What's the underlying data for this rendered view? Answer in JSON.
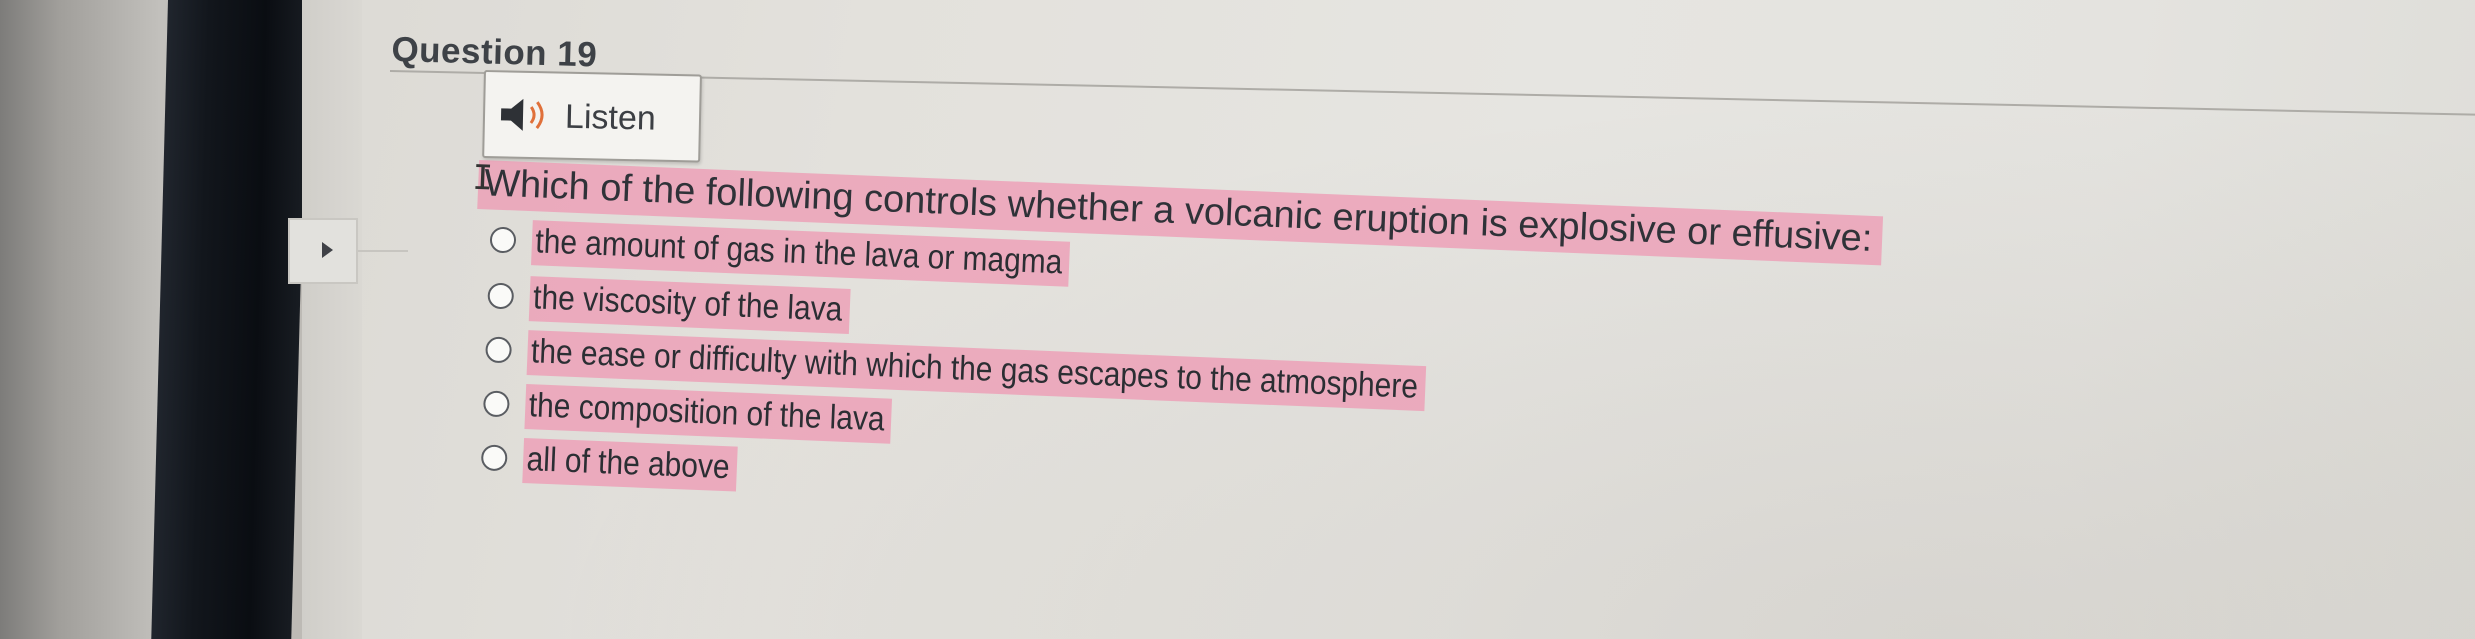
{
  "question": {
    "title": "Question 19",
    "listen_label": "Listen",
    "prompt": "Which of the following controls whether a volcanic eruption is explosive or effusive:",
    "options": [
      {
        "label": "the amount of gas in the lava or magma",
        "selected": false
      },
      {
        "label": "the viscosity of the lava",
        "selected": false
      },
      {
        "label": "the ease or difficulty with which the gas escapes to the atmosphere",
        "selected": false
      },
      {
        "label": "the composition of the lava",
        "selected": false
      },
      {
        "label": "all of the above",
        "selected": false
      }
    ]
  },
  "icons": {
    "listen": "speaker-icon",
    "expander": "triangle-right-icon",
    "cursor": "text-cursor-icon"
  },
  "colors": {
    "highlight": "#ee96b2",
    "text": "#2f3238",
    "screen_bg": "#e4e3df"
  }
}
